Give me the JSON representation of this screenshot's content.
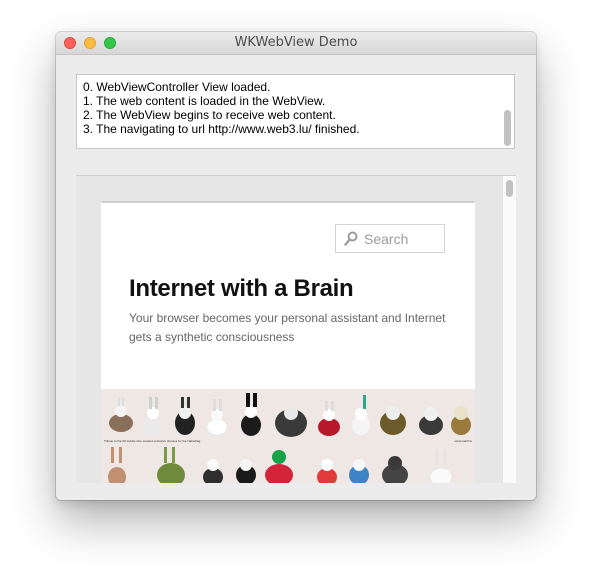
{
  "window": {
    "title": "WKWebView Demo"
  },
  "log": {
    "lines": [
      "0. WebViewController View loaded.",
      "1. The web content is loaded in the WebView.",
      "2. The WebView begins to receive web content.",
      "3. The navigating to url http://www.web3.lu/ finished."
    ]
  },
  "webpage": {
    "search_placeholder": "Search",
    "site_title": "Internet with a Brain",
    "tagline": "Your browser becomes your personal assistant and Internet gets a synthetic consciousness",
    "banner": {
      "caption_left": "Tribute to the 60 stylists who created exclusive dresses for the Nabaztag",
      "caption_right": "www.web3.lu"
    }
  },
  "colors": {
    "close": "#fc605c",
    "minimize": "#fdbc40",
    "maximize": "#34c749",
    "banner_bg": "#efe7e3"
  },
  "icons": [
    "close-icon",
    "minimize-icon",
    "maximize-icon",
    "search-icon"
  ]
}
